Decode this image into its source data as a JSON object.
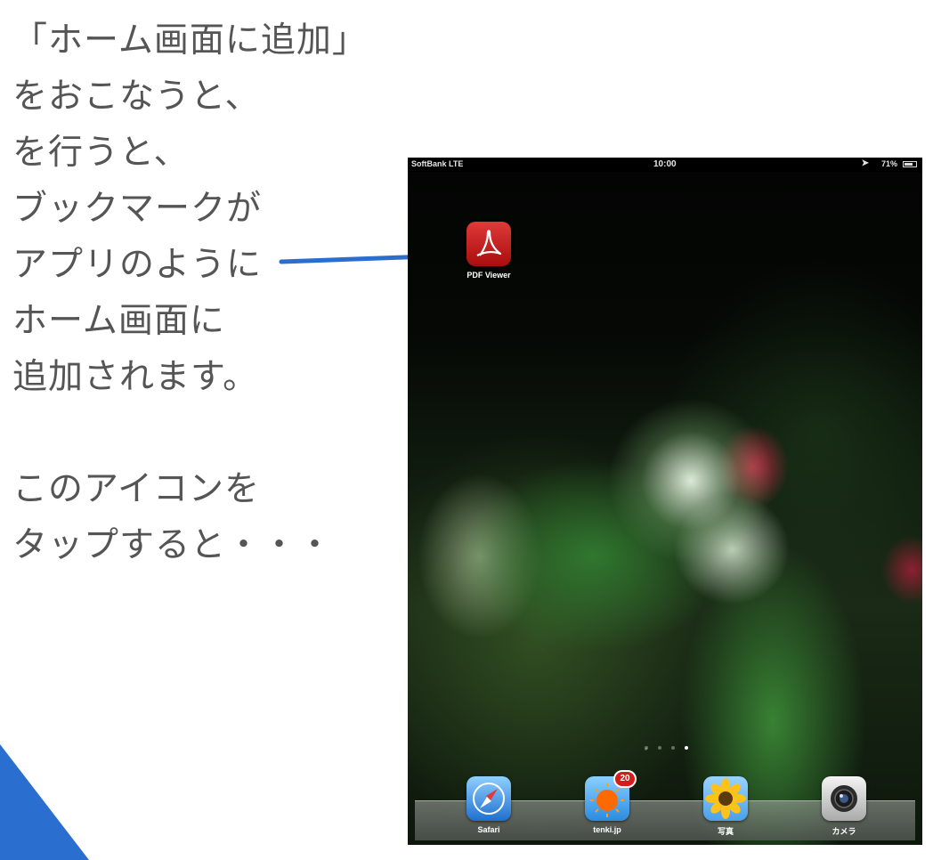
{
  "caption": {
    "lines": [
      "「ホーム画面に追加」",
      "をおこなうと、",
      "を行うと、",
      "ブックマークが",
      "アプリのように",
      "ホーム画面に",
      "追加されます。",
      "このアイコンを",
      "タップすると・・・"
    ]
  },
  "statusbar": {
    "carrier": "SoftBank  LTE",
    "time": "10:00",
    "battery": "71%"
  },
  "home": {
    "apps": [
      {
        "label": "PDF Viewer",
        "icon": "pdf-icon"
      }
    ],
    "page_count": 4,
    "active_page": 4
  },
  "dock": {
    "apps": [
      {
        "label": "Safari",
        "icon": "safari-icon"
      },
      {
        "label": "tenki.jp",
        "icon": "weather-sun-icon",
        "badge": "20"
      },
      {
        "label": "写真",
        "icon": "sunflower-photos-icon"
      },
      {
        "label": "カメラ",
        "icon": "camera-icon"
      }
    ]
  },
  "colors": {
    "accent": "#2a6fcf",
    "caption_text": "#555555",
    "badge": "#d41c1c"
  }
}
